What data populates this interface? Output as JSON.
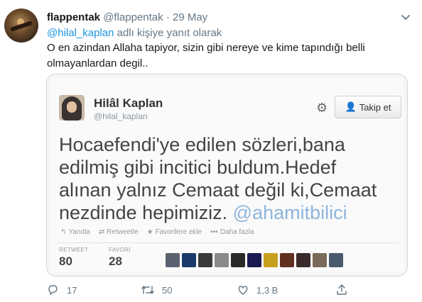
{
  "tweet": {
    "author_name": "flappentak",
    "author_handle": "@flappentak",
    "separator": "·",
    "date": "29 May",
    "reply_mention": "@hilal_kaplan",
    "reply_suffix": "adlı kişiye yanıt olarak",
    "text": "O en azindan Allaha tapiyor, sizin gibi  nereye ve kime tapındığı belli olmayanlardan degil.."
  },
  "embedded": {
    "name": "Hilâl Kaplan",
    "handle": "@hilal_kaplan",
    "follow_label": "Takip et",
    "body": "Hocaefendi'ye edilen sözleri,bana edilmiş gibi incitici buldum.Hedef alınan yalnız Cemaat değil ki,Cemaat nezdinde hepimiziz.",
    "body_mention": "@ahamitbilici",
    "actions": [
      "Yanıtla",
      "Retweetle",
      "Favorilere ekle",
      "Daha fazla"
    ],
    "retweet_label": "RETWEET",
    "retweet_count": "80",
    "favori_label": "FAVORİ",
    "favori_count": "28",
    "thumb_colors": [
      "#5a6270",
      "#1a3a6a",
      "#3a3a3a",
      "#8a8a8a",
      "#2a2a2a",
      "#1a1a50",
      "#c8a020",
      "#603020",
      "#3a2a2a",
      "#7a6a5a",
      "#4a5a6a"
    ]
  },
  "footer": {
    "replies": "17",
    "retweets": "50",
    "likes": "1,3 B"
  },
  "icons": {
    "reply": "reply-icon",
    "retweet": "retweet-icon",
    "like": "heart-icon",
    "share": "share-icon",
    "chevron": "chevron-down-icon"
  }
}
